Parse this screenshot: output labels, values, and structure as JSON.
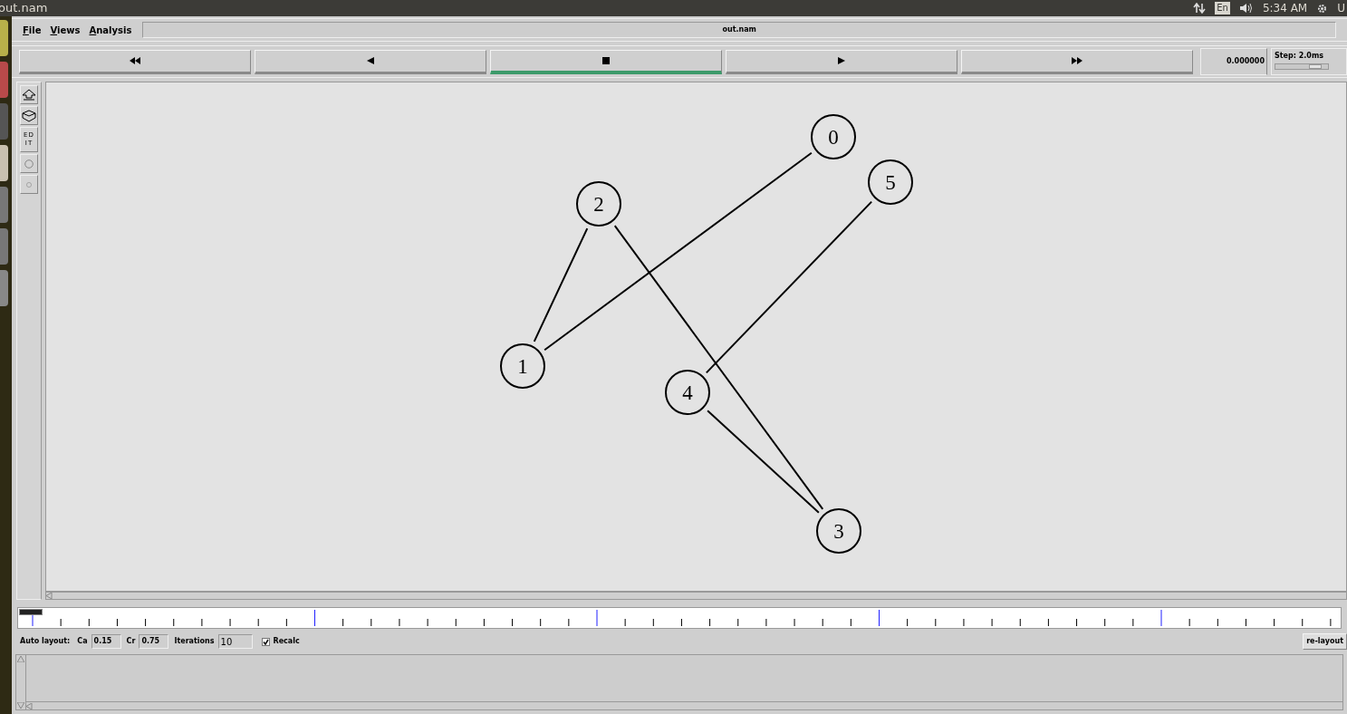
{
  "top_bar": {
    "title": "out.nam",
    "keyboard": "En",
    "clock": "5:34 AM",
    "user": "U"
  },
  "menu": [
    "File",
    "Views",
    "Analysis"
  ],
  "window_title": "out.nam",
  "playback": [
    {
      "kind": "rewind",
      "selected": false
    },
    {
      "kind": "back",
      "selected": false
    },
    {
      "kind": "stop",
      "selected": true
    },
    {
      "kind": "play",
      "selected": false
    },
    {
      "kind": "fastforward",
      "selected": false
    }
  ],
  "time": "0.000000",
  "step": {
    "label": "Step: 2.0ms",
    "level": 0.75
  },
  "tools": [
    {
      "kind": "zoom-in"
    },
    {
      "kind": "zoom-out"
    },
    {
      "kind": "edit",
      "label": "EDIT"
    },
    {
      "kind": "large-circle"
    },
    {
      "kind": "small-circle"
    }
  ],
  "nodes": [
    {
      "label": "0"
    },
    {
      "label": "1"
    },
    {
      "label": "2"
    },
    {
      "label": "3"
    },
    {
      "label": "4"
    },
    {
      "label": "5"
    }
  ],
  "auto_layout": {
    "label": "Auto layout:",
    "fields": [
      {
        "label": "Ca",
        "value": "0.15"
      },
      {
        "label": "Cr",
        "value": "0.75"
      },
      {
        "label": "Iterations",
        "value": "10"
      }
    ],
    "recalc": {
      "label": "Recalc",
      "checked": true
    },
    "button": "re-layout"
  }
}
